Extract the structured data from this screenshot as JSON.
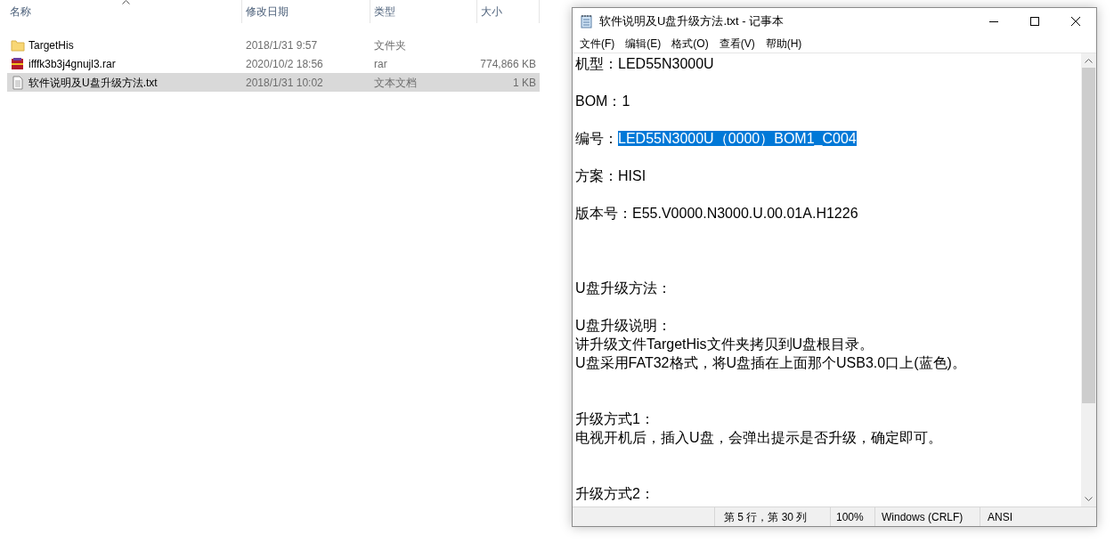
{
  "explorer": {
    "columns": [
      "名称",
      "修改日期",
      "类型",
      "大小"
    ],
    "rows": [
      {
        "kind": "folder",
        "name": "TargetHis",
        "date": "2018/1/31 9:57",
        "type": "文件夹",
        "size": "",
        "selected": false
      },
      {
        "kind": "archive",
        "name": "ifffk3b3j4gnujl3.rar",
        "date": "2020/10/2 18:56",
        "type": "rar",
        "size": "774,866 KB",
        "selected": false
      },
      {
        "kind": "text",
        "name": "软件说明及U盘升级方法.txt",
        "date": "2018/1/31 10:02",
        "type": "文本文档",
        "size": "1 KB",
        "selected": true
      }
    ]
  },
  "notepad": {
    "title": "软件说明及U盘升级方法.txt - 记事本",
    "menu": [
      "文件(F)",
      "编辑(E)",
      "格式(O)",
      "查看(V)",
      "帮助(H)"
    ],
    "lines": [
      {
        "kind": "text",
        "text": "机型：LED55N3000U"
      },
      {
        "kind": "blank"
      },
      {
        "kind": "text",
        "text": "BOM：1"
      },
      {
        "kind": "blank"
      },
      {
        "kind": "text",
        "text": "编号：",
        "selection": "LED55N3000U（0000）BOM1_C004"
      },
      {
        "kind": "blank"
      },
      {
        "kind": "text",
        "text": "方案：HISI"
      },
      {
        "kind": "blank"
      },
      {
        "kind": "text",
        "text": "版本号：E55.V0000.N3000.U.00.01A.H1226"
      },
      {
        "kind": "blank"
      },
      {
        "kind": "blank"
      },
      {
        "kind": "blank"
      },
      {
        "kind": "text",
        "text": "U盘升级方法："
      },
      {
        "kind": "blank"
      },
      {
        "kind": "text",
        "text": "U盘升级说明："
      },
      {
        "kind": "text",
        "text": "讲升级文件TargetHis文件夹拷贝到U盘根目录。"
      },
      {
        "kind": "text",
        "text": "U盘采用FAT32格式，将U盘插在上面那个USB3.0口上(蓝色)。"
      },
      {
        "kind": "blank"
      },
      {
        "kind": "blank"
      },
      {
        "kind": "text",
        "text": "升级方式1："
      },
      {
        "kind": "text",
        "text": "电视开机后，插入U盘，会弹出提示是否升级，确定即可。"
      },
      {
        "kind": "blank"
      },
      {
        "kind": "blank"
      },
      {
        "kind": "text",
        "text": "升级方式2："
      }
    ],
    "status": [
      "第 5 行，第 30 列",
      "100%",
      "Windows (CRLF)",
      "ANSI"
    ]
  }
}
